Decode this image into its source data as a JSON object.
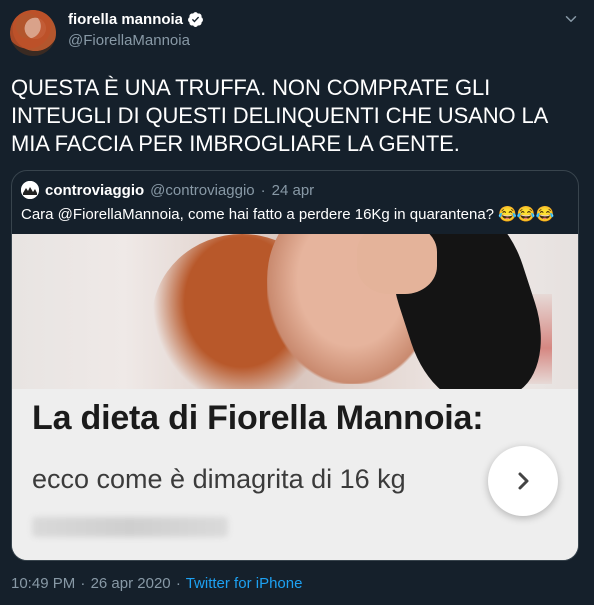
{
  "author": {
    "name": "fiorella mannoia",
    "handle": "@FiorellaMannoia",
    "verified": true
  },
  "tweet": {
    "text": "QUESTA È UNA TRUFFA. NON COMPRATE GLI INTEUGLI DI QUESTI DELINQUENTI CHE USANO LA MIA FACCIA PER IMBROGLIARE LA GENTE."
  },
  "quoted": {
    "name": "controviaggio",
    "handle": "@controviaggio",
    "dot": "·",
    "date": "24 apr",
    "text": "Cara @FiorellaMannoia, come hai fatto a perdere 16Kg in quarantena?",
    "emojis": "😂😂😂",
    "image": {
      "headline": "La dieta di Fiorella Mannoia:",
      "subhead": "ecco come è dimagrita di 16 kg",
      "next_icon": "chevron-right-icon"
    }
  },
  "footer": {
    "time": "10:49 PM",
    "dot": "·",
    "date": "26 apr 2020",
    "source": "Twitter for iPhone"
  },
  "colors": {
    "background": "#15202b",
    "secondary_text": "#8899a6",
    "link": "#1da1f2",
    "border": "#38444d"
  }
}
